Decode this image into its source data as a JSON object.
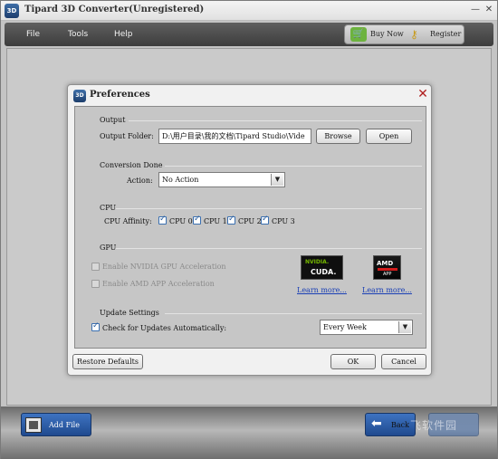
{
  "app": {
    "title": "Tipard 3D Converter(Unregistered)",
    "icon_text": "3D"
  },
  "menu": {
    "items": [
      "File",
      "Tools",
      "Help"
    ],
    "buy_now": "Buy Now",
    "register": "Register"
  },
  "dialog": {
    "title": "Preferences",
    "icon_text": "3D",
    "output": {
      "section": "Output",
      "folder_label": "Output Folder:",
      "folder_value": "D:\\用户目录\\我的文档\\Tipard Studio\\Vide",
      "browse": "Browse",
      "open": "Open"
    },
    "conversion_done": {
      "section": "Conversion Done",
      "action_label": "Action:",
      "action_value": "No Action"
    },
    "cpu": {
      "section": "CPU",
      "affinity_label": "CPU Affinity:",
      "cores": [
        {
          "label": "CPU 0",
          "checked": true
        },
        {
          "label": "CPU 1",
          "checked": true
        },
        {
          "label": "CPU 2",
          "checked": true
        },
        {
          "label": "CPU 3",
          "checked": true
        }
      ]
    },
    "gpu": {
      "section": "GPU",
      "nvidia_label": "Enable NVIDIA GPU Acceleration",
      "amd_label": "Enable AMD APP Acceleration",
      "nvidia_brand": "NVIDIA.",
      "nvidia_product": "CUDA.",
      "amd_brand": "AMD",
      "amd_product": "APP",
      "learn_more_nvidia": "Learn more...",
      "learn_more_amd": "Learn more..."
    },
    "updates": {
      "section": "Update Settings",
      "check_label": "Check for Updates Automatically:",
      "checked": true,
      "frequency": "Every Week"
    },
    "restore_defaults": "Restore Defaults",
    "ok": "OK",
    "cancel": "Cancel"
  },
  "footer": {
    "add_file": "Add File",
    "back": "Back",
    "watermark": "飞软件园"
  },
  "colors": {
    "menubar": "#4a4a4a",
    "accent_blue": "#2b5aa3",
    "link": "#1a3fb5",
    "close_red": "#b01e1e"
  }
}
